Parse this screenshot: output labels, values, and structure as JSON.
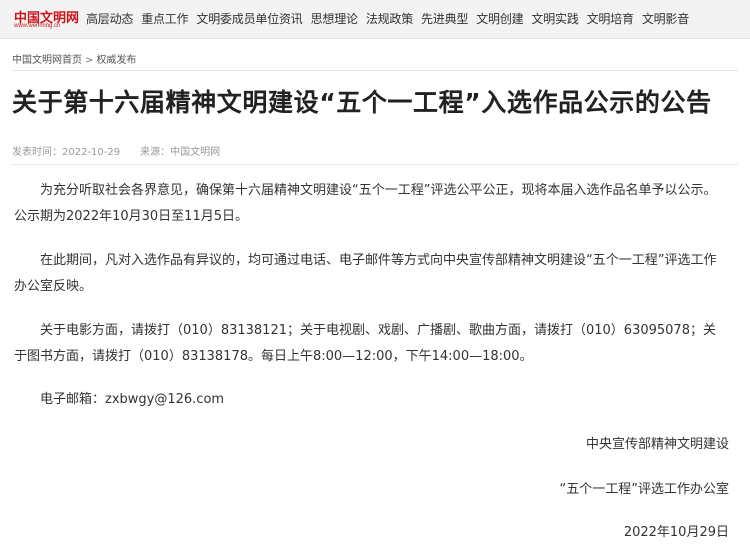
{
  "site": {
    "logo_text": "中国文明网",
    "logo_url": "www.wenming.cn"
  },
  "nav": {
    "items": [
      {
        "label": "高层动态"
      },
      {
        "label": "重点工作"
      },
      {
        "label": "文明委成员单位资讯"
      },
      {
        "label": "思想理论"
      },
      {
        "label": "法规政策"
      },
      {
        "label": "先进典型"
      },
      {
        "label": "文明创建"
      },
      {
        "label": "文明实践"
      },
      {
        "label": "文明培育"
      },
      {
        "label": "文明影音"
      }
    ]
  },
  "breadcrumb": {
    "home": "中国文明网首页",
    "separator": ">",
    "current": "权威发布"
  },
  "article": {
    "title": "关于第十六届精神文明建设“五个一工程”入选作品公示的公告",
    "publish_time": "发表时间：2022-10-29",
    "source": "来源：中国文明网",
    "paragraphs": [
      "为充分听取社会各界意见，确保第十六届精神文明建设“五个一工程”评选公平公正，现将本届入选作品名单予以公示。公示期为2022年10月30日至11月5日。",
      "在此期间，凡对入选作品有异议的，均可通过电话、电子邮件等方式向中央宣传部精神文明建设“五个一工程”评选工作办公室反映。",
      "关于电影方面，请拨打（010）83138121；关于电视剧、戏剧、广播剧、歌曲方面，请拨打（010）63095078；关于图书方面，请拨打（010）83138178。每日上午8:00—12:00，下午14:00—18:00。",
      "电子邮箱：zxbwgy@126.com"
    ],
    "signature": {
      "org": "中央宣传部精神文明建设",
      "office": "“五个一工程”评选工作办公室",
      "date": "2022年10月29日"
    }
  }
}
